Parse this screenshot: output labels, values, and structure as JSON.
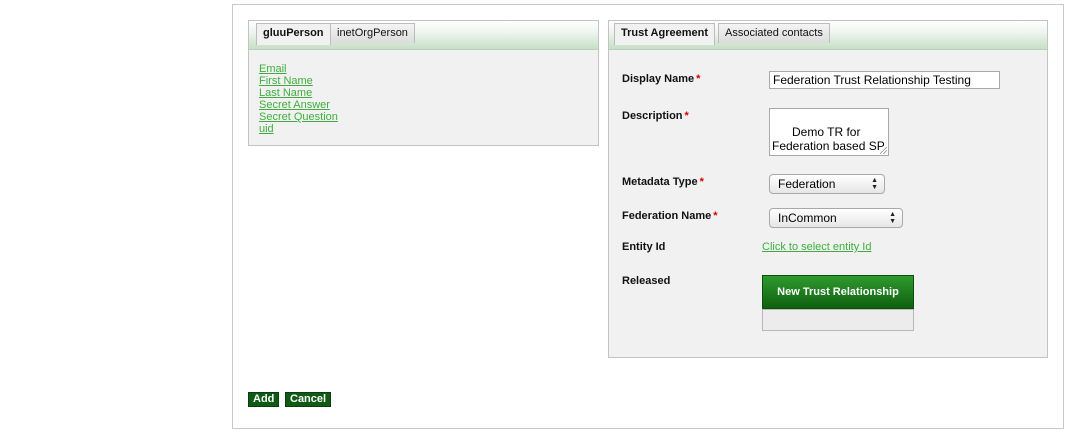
{
  "left_panel": {
    "tabs": [
      {
        "label": "gluuPerson",
        "active": true
      },
      {
        "label": "inetOrgPerson",
        "active": false
      }
    ],
    "attributes": [
      "Email",
      "First Name",
      "Last Name",
      "Secret Answer",
      "Secret Question",
      "uid"
    ]
  },
  "right_panel": {
    "tabs": [
      {
        "label": "Trust Agreement",
        "active": true
      },
      {
        "label": "Associated contacts",
        "active": false
      }
    ],
    "display_name": {
      "label": "Display Name",
      "required": "*",
      "value": "Federation Trust Relationship Testing"
    },
    "description": {
      "label": "Description",
      "required": "*",
      "value": "Demo TR for\nFederation based SP"
    },
    "metadata_type": {
      "label": "Metadata Type",
      "required": "*",
      "value": "Federation"
    },
    "federation_name": {
      "label": "Federation Name",
      "required": "*",
      "value": "InCommon"
    },
    "entity_id": {
      "label": "Entity Id",
      "link": "Click to select entity Id"
    },
    "released": {
      "label": "Released",
      "button": "New Trust Relationship"
    }
  },
  "actions": {
    "add": "Add",
    "cancel": "Cancel"
  },
  "colors": {
    "accent_green": "#106010",
    "link_green": "#3fae3f",
    "required_red": "#d40000"
  }
}
